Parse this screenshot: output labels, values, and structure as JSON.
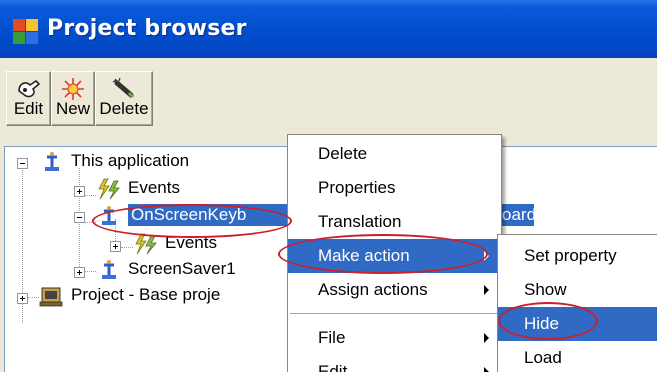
{
  "window": {
    "title": "Project browser"
  },
  "toolbar": {
    "edit_label": "Edit",
    "new_label": "New",
    "delete_label": "Delete"
  },
  "tree": {
    "items": [
      {
        "label": "This application",
        "icon": "app-node-icon",
        "expanded": true
      },
      {
        "label": "Events",
        "icon": "events-icon",
        "expanded": false
      },
      {
        "label": "OnScreenKeyboard",
        "icon": "app-node-icon",
        "expanded": true,
        "selected": true
      },
      {
        "label": "Events",
        "icon": "events-icon",
        "expanded": false
      },
      {
        "label": "ScreenSaver1",
        "icon": "app-node-icon",
        "expanded": false
      },
      {
        "label": "Project - Base project",
        "icon": "project-icon",
        "expanded": false
      }
    ],
    "visible_fragments": {
      "row2_left": "OnScreenKeyb",
      "row2_right": "oard",
      "row5": "Project - Base proje"
    }
  },
  "context_menu": {
    "items": [
      "Delete",
      "Properties",
      "Translation",
      "Make action",
      "Assign actions",
      "File",
      "Edit"
    ],
    "highlighted": "Make action"
  },
  "submenu": {
    "items": [
      "Set property",
      "Show",
      "Hide",
      "Load"
    ],
    "highlighted": "Hide"
  },
  "colors": {
    "titlebar": "#0250d0",
    "selection": "#316ac5",
    "annotation": "#c8202c",
    "face": "#ece9d8"
  }
}
